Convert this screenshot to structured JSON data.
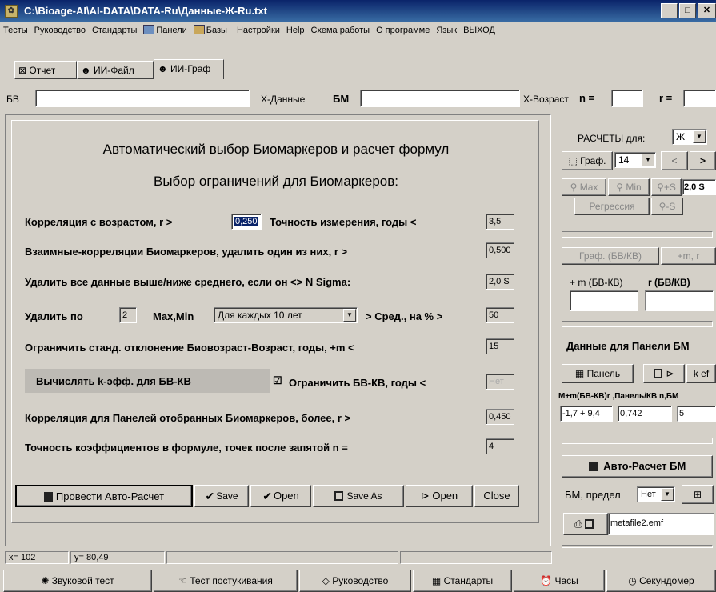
{
  "window": {
    "title": "C:\\Bioage-AI\\AI-DATA\\DATA-Ru\\Данные-Ж-Ru.txt"
  },
  "menu": [
    "Тесты",
    "Руководство",
    "Стандарты",
    "Панели",
    "Базы",
    "Настройки",
    "Help",
    "Схема работы",
    "О программе",
    "Язык",
    "ВЫХОД"
  ],
  "tabs": [
    "Отчет",
    "ИИ-Файл",
    "ИИ-Граф"
  ],
  "top": {
    "bv_label": "БВ",
    "bv_value": "",
    "xdata_label": "Х-Данные",
    "bm_label": "БМ",
    "bm_value": "",
    "xage_label": "Х-Возраст",
    "n_label": "n =",
    "n_value": "",
    "r_label": "r =",
    "r_value": ""
  },
  "main": {
    "title1": "Автоматический выбор Биомаркеров и расчет формул",
    "title2": "Выбор ограничений для Биомаркеров:",
    "corr_label": "Корреляция с возрастом, r >",
    "corr_value": "0,250",
    "accuracy_label": "Точность измерения, годы <",
    "accuracy_value": "3,5",
    "mutual_label": "Взаимные-корреляции Биомаркеров, удалить один из них,   r  >",
    "mutual_value": "0,500",
    "sigma_label": "Удалить все данные выше/ниже среднего, если он  <> N Sigma:",
    "sigma_value": "2,0 S",
    "del_label": "Удалить по",
    "del_value": "2",
    "maxmin_label": "Max,Min",
    "period_value": "Для каждых 10 лет",
    "avg_label": "> Сред., на % >",
    "avg_value": "50",
    "std_label": "Ограничить станд. отклонение Биовозраст-Возраст, годы,  +m  <",
    "std_value": "15",
    "keff_label": "Вычислять k-эфф. для БВ-КВ",
    "limit_label": "Ограничить БВ-КВ, годы <",
    "limit_value": "Нет",
    "panel_corr_label": "Корреляция для Панелей отобранных Биомаркеров, более,  r >",
    "panel_corr_value": "0,450",
    "prec_label": "Точность коэффициентов в формуле, точек после запятой  n  =",
    "prec_value": "4",
    "buttons": {
      "auto": "Провести Авто-Расчет",
      "save": "Save",
      "open": "Open",
      "saveas": "Save As",
      "open2": "Open",
      "close": "Close"
    }
  },
  "right": {
    "calc_label": "РАСЧЕТЫ для:",
    "calc_value": "Ж",
    "graph_btn": "Граф.",
    "graph_num": "14",
    "prev": "<",
    "next": ">",
    "max": "Max",
    "min": "Min",
    "plus_s": "+S",
    "s_value": "2,0 S",
    "regression": "Регрессия",
    "minus_s": "-S",
    "graph_bvkv": "Граф. (БВ/КВ)",
    "plus_mr": "+m, r",
    "m_label": "+ m (БВ-КВ)",
    "r_label": "r (БВ/КВ)",
    "m_value": "",
    "r_value": "",
    "panel_data": "Данные для Панели БМ",
    "panel_btn": "Панель",
    "kef_btn": "k ef",
    "cols": "M+m(БВ-КВ)r ,Панель/КВ  n,БМ",
    "val1": "-1,7 + 9,4",
    "val2": "0,742",
    "val3": "5",
    "auto_bm": "Авто-Расчет БМ",
    "limit_label": "БМ, предел",
    "limit_value": "Нет",
    "file_value": "metafile2.emf"
  },
  "status": {
    "x": "x= 102",
    "y": "y= 80,49"
  },
  "bottom": [
    "Звуковой тест",
    "Тест постукивания",
    "Руководство",
    "Стандарты",
    "Часы",
    "Секундомер"
  ]
}
